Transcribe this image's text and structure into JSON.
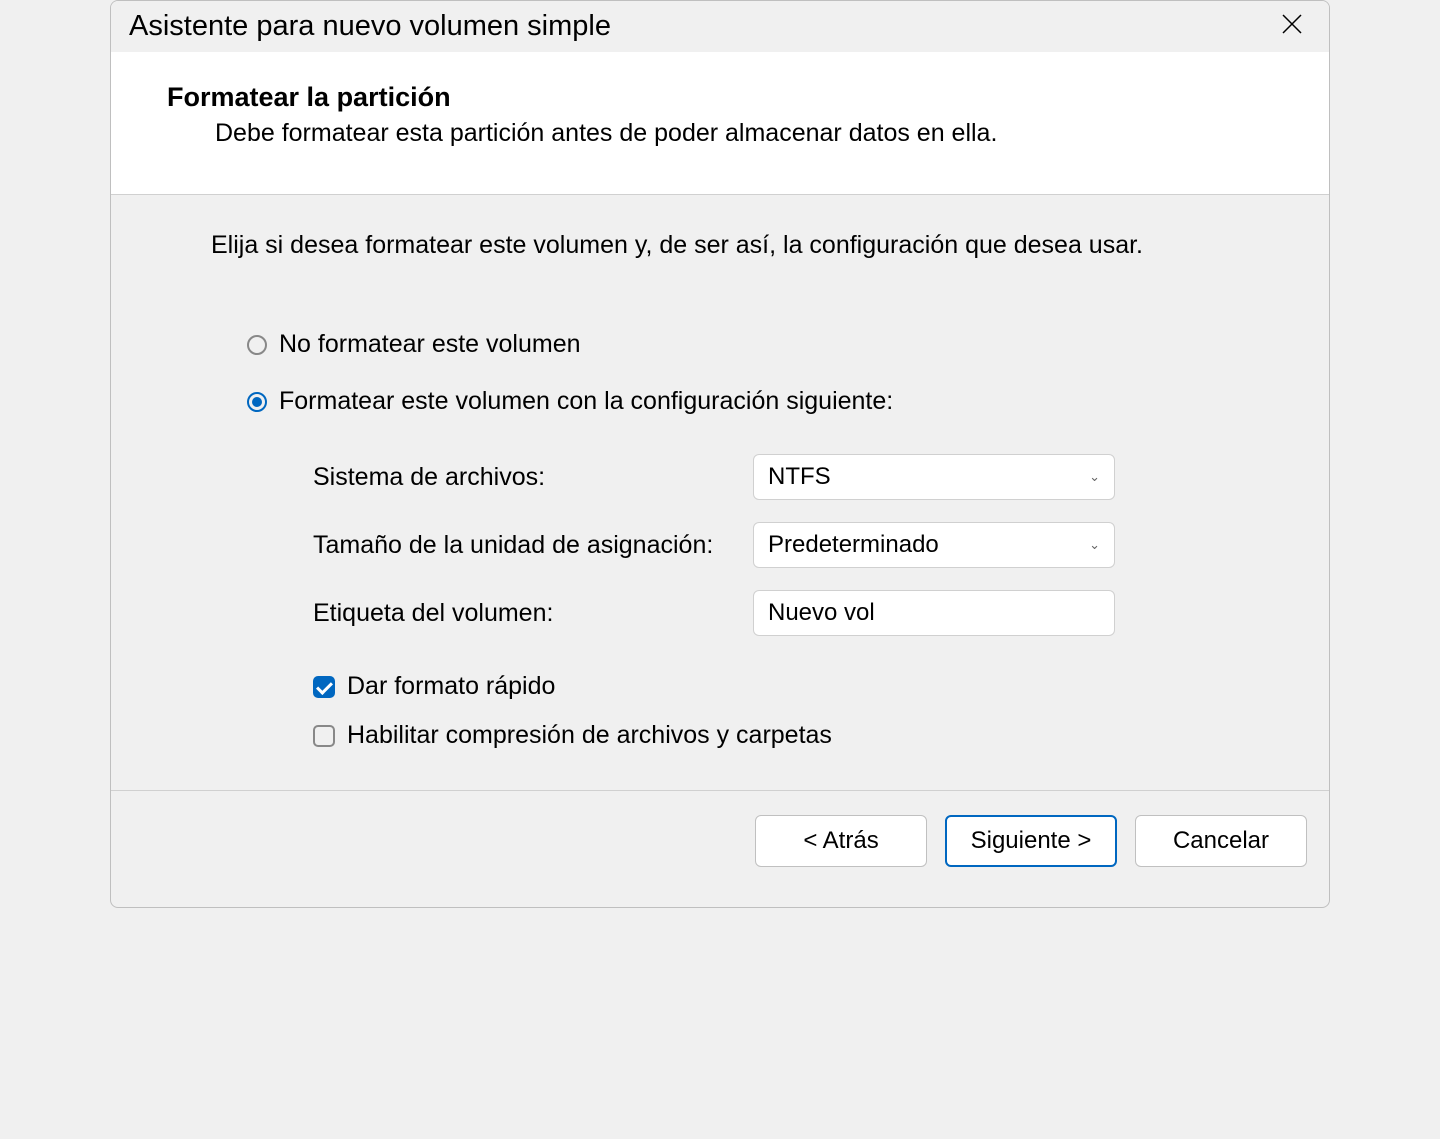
{
  "titlebar": {
    "title": "Asistente para nuevo volumen simple"
  },
  "header": {
    "title": "Formatear la partición",
    "subtitle": "Debe formatear esta partición antes de poder almacenar datos en ella."
  },
  "content": {
    "instruction": "Elija si desea formatear este volumen y, de ser así, la configuración que desea usar.",
    "radio_no_format": "No formatear este volumen",
    "radio_format": "Formatear este volumen con la configuración siguiente:",
    "fs_label": "Sistema de archivos:",
    "fs_value": "NTFS",
    "alloc_label": "Tamaño de la unidad de asignación:",
    "alloc_value": "Predeterminado",
    "vol_label": "Etiqueta del volumen:",
    "vol_value": "Nuevo vol",
    "quick_format": "Dar formato rápido",
    "compression": "Habilitar compresión de archivos y carpetas"
  },
  "footer": {
    "back": "< Atrás",
    "next": "Siguiente >",
    "cancel": "Cancelar"
  }
}
